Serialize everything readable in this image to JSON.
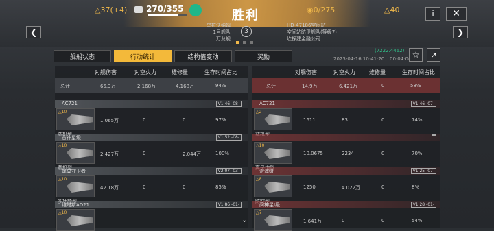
{
  "header": {
    "left_value": "37(+4)",
    "supply": "270/355",
    "title": "胜利",
    "right_score": "0/275",
    "right_value": "40"
  },
  "info": {
    "left_lines": [
      "乌拉沃纳姆",
      "1号舰队",
      "万龙舰"
    ],
    "round": "3",
    "right_lines": [
      "HD-47186空间站",
      "空间站防卫舰队(等级7)",
      "坎探建金融公司"
    ]
  },
  "tabs": [
    "舰船状态",
    "行动统计",
    "结构值变动",
    "奖励"
  ],
  "meta": {
    "id": "(7222.4462)",
    "time": "2023-04-16 10:41:20",
    "duration": "00:04:04"
  },
  "columns": [
    "对舰伤害",
    "对空火力",
    "维修量",
    "生存时间占比"
  ],
  "left": {
    "total_label": "总计",
    "totals": [
      "65.3万",
      "2.168万",
      "4.168万",
      "94%"
    ],
    "ships": [
      {
        "name": "AC721",
        "ver": "V1.46 -08-",
        "level": "10",
        "type": "载机型",
        "values": [
          "1,065万",
          "0",
          "0",
          "97%"
        ]
      },
      {
        "name": "谷神星级",
        "ver": "V1.52 -08-",
        "level": "10",
        "type": "载机型",
        "values": [
          "2,427万",
          "0",
          "2,044万",
          "100%"
        ]
      },
      {
        "name": "蜂巢守卫者",
        "ver": "V2.07 -03-",
        "level": "10",
        "type": "多功能型",
        "values": [
          "42.18万",
          "0",
          "0",
          "85%"
        ]
      },
      {
        "name": "维塔斯AD21",
        "ver": "V1.86 -01-",
        "level": "10",
        "type": "",
        "values": [
          "",
          "",
          "",
          ""
        ]
      }
    ]
  },
  "right": {
    "total_label": "总计",
    "totals": [
      "14.9万",
      "6.421万",
      "0",
      "58%"
    ],
    "ships": [
      {
        "name": "AC721",
        "ver": "V1.46 -07-",
        "level": "2",
        "type": "载机型",
        "values": [
          "1611",
          "83",
          "0",
          "74%"
        ]
      },
      {
        "name": "",
        "ver": "",
        "level": "10",
        "type": "离子炮型",
        "values": [
          "10.0675",
          "2234",
          "0",
          "70%"
        ]
      },
      {
        "name": "澄海级",
        "ver": "V1.25 -07-",
        "level": "8",
        "type": "防空型",
        "values": [
          "1250",
          "4.022万",
          "0",
          "8%"
        ]
      },
      {
        "name": "阋神星I级",
        "ver": "V1.28 -01-",
        "level": "7",
        "type": "",
        "values": [
          "1.641万",
          "0",
          "0",
          "54%"
        ]
      }
    ]
  },
  "icons": [
    "info-icon",
    "close-icon",
    "star-icon",
    "share-icon",
    "chevron-left-icon",
    "chevron-right-icon",
    "chevron-down-icon"
  ]
}
